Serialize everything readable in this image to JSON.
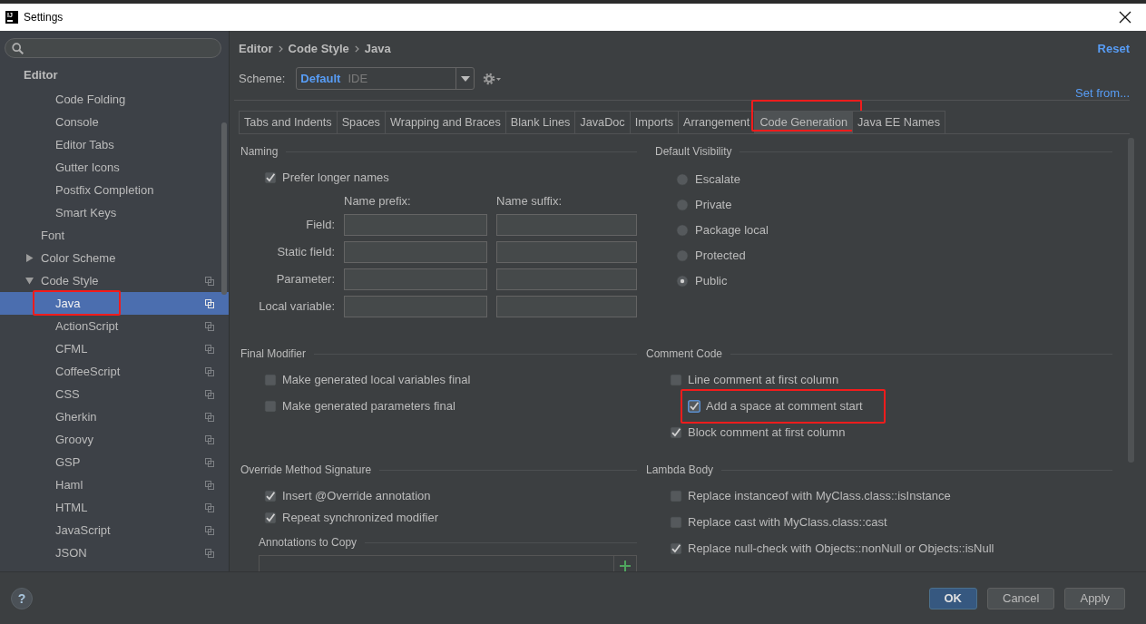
{
  "window": {
    "logo": "IJ",
    "title": "Settings"
  },
  "sidebar": {
    "tree": [
      {
        "label": "Editor",
        "selected": false,
        "children": [
          {
            "children": [
              {
                "label": "Code Folding",
                "selected": false
              },
              {
                "label": "Console",
                "selected": false
              },
              {
                "label": "Editor Tabs",
                "selected": false
              },
              {
                "label": "Gutter Icons",
                "selected": false
              },
              {
                "label": "Postfix Completion",
                "selected": false
              },
              {
                "label": "Smart Keys",
                "selected": false
              }
            ]
          },
          {
            "label": "Font",
            "selected": false
          },
          {
            "label": "Color Scheme",
            "selected": false,
            "expanded": false
          },
          {
            "label": "Code Style",
            "selected": false,
            "expanded": true,
            "copy_icon": true,
            "children": [
              {
                "label": "Java",
                "selected": true,
                "copy_icon": true,
                "annotated": true
              },
              {
                "label": "ActionScript",
                "selected": false,
                "copy_icon": true
              },
              {
                "label": "CFML",
                "selected": false,
                "copy_icon": true
              },
              {
                "label": "CoffeeScript",
                "selected": false,
                "copy_icon": true
              },
              {
                "label": "CSS",
                "selected": false,
                "copy_icon": true
              },
              {
                "label": "Gherkin",
                "selected": false,
                "copy_icon": true
              },
              {
                "label": "Groovy",
                "selected": false,
                "copy_icon": true
              },
              {
                "label": "GSP",
                "selected": false,
                "copy_icon": true
              },
              {
                "label": "Haml",
                "selected": false,
                "copy_icon": true
              },
              {
                "label": "HTML",
                "selected": false,
                "copy_icon": true
              },
              {
                "label": "JavaScript",
                "selected": false,
                "copy_icon": true
              },
              {
                "label": "JSON",
                "selected": false,
                "copy_icon": true
              }
            ]
          }
        ]
      }
    ]
  },
  "header": {
    "breadcrumb": [
      "Editor",
      "Code Style",
      "Java"
    ],
    "reset_link": "Reset",
    "scheme": {
      "label": "Scheme:",
      "value": "Default",
      "value_hint": "IDE"
    },
    "set_from_link": "Set from..."
  },
  "tabs": [
    {
      "label": "Tabs and Indents",
      "selected": false
    },
    {
      "label": "Spaces",
      "selected": false
    },
    {
      "label": "Wrapping and Braces",
      "selected": false
    },
    {
      "label": "Blank Lines",
      "selected": false
    },
    {
      "label": "JavaDoc",
      "selected": false
    },
    {
      "label": "Imports",
      "selected": false
    },
    {
      "label": "Arrangement",
      "selected": false
    },
    {
      "label": "Code Generation",
      "selected": true,
      "annotated": true
    },
    {
      "label": "Java EE Names",
      "selected": false
    }
  ],
  "panel": {
    "columns": [
      {
        "sections": [
          {
            "title": "Naming",
            "items": [
              {
                "kind": "checkbox",
                "label": "Prefer longer names",
                "checked": true
              },
              {
                "kind": "name_fields",
                "headers": [
                  "Name prefix:",
                  "Name suffix:"
                ],
                "rows": [
                  {
                    "label": "Field:"
                  },
                  {
                    "label": "Static field:"
                  },
                  {
                    "label": "Parameter:"
                  },
                  {
                    "label": "Local variable:"
                  }
                ]
              }
            ]
          },
          {
            "title": "Final Modifier",
            "items": [
              {
                "kind": "checkbox",
                "label": "Make generated local variables final",
                "checked": false
              },
              {
                "kind": "checkbox",
                "label": "Make generated parameters final",
                "checked": false
              }
            ]
          },
          {
            "title": "Override Method Signature",
            "items": [
              {
                "kind": "checkbox",
                "label": "Insert @Override annotation",
                "checked": true
              },
              {
                "kind": "checkbox",
                "label": "Repeat synchronized modifier",
                "checked": true
              },
              {
                "kind": "list",
                "title": "Annotations to Copy"
              }
            ]
          }
        ]
      },
      {
        "sections": [
          {
            "title": "Default Visibility",
            "items": [
              {
                "kind": "radio",
                "label": "Escalate",
                "selected": false
              },
              {
                "kind": "radio",
                "label": "Private",
                "selected": false
              },
              {
                "kind": "radio",
                "label": "Package local",
                "selected": false
              },
              {
                "kind": "radio",
                "label": "Protected",
                "selected": false
              },
              {
                "kind": "radio",
                "label": "Public",
                "selected": true
              }
            ]
          },
          {
            "title": "Comment Code",
            "items": [
              {
                "kind": "checkbox",
                "label": "Line comment at first column",
                "checked": false,
                "children": [
                  {
                    "kind": "checkbox",
                    "label": "Add a space at comment start",
                    "checked": true,
                    "focused": true,
                    "annotated": true
                  }
                ]
              },
              {
                "kind": "checkbox",
                "label": "Block comment at first column",
                "checked": true
              }
            ]
          },
          {
            "title": "Lambda Body",
            "items": [
              {
                "kind": "checkbox",
                "label": "Replace instanceof with MyClass.class::isInstance",
                "checked": false
              },
              {
                "kind": "checkbox",
                "label": "Replace cast with MyClass.class::cast",
                "checked": false
              },
              {
                "kind": "checkbox",
                "label": "Replace null-check with Objects::nonNull or Objects::isNull",
                "checked": true
              }
            ]
          }
        ]
      }
    ]
  },
  "footer": {
    "help": "?",
    "buttons": [
      {
        "label": "OK",
        "default": true
      },
      {
        "label": "Cancel",
        "default": false
      },
      {
        "label": "Apply",
        "default": false
      }
    ]
  }
}
